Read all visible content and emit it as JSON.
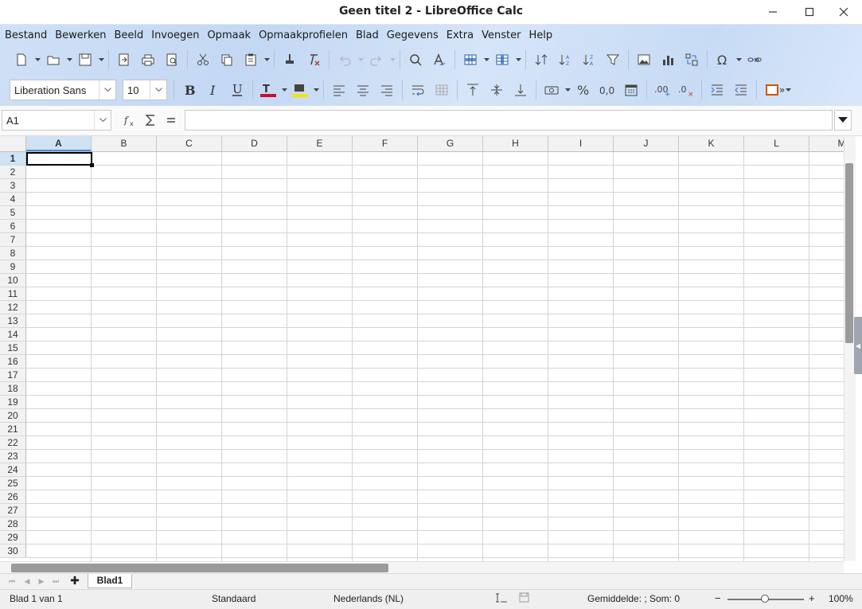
{
  "window": {
    "title": "Geen titel 2 - LibreOffice Calc"
  },
  "menu": [
    "Bestand",
    "Bewerken",
    "Beeld",
    "Invoegen",
    "Opmaak",
    "Opmaakprofielen",
    "Blad",
    "Gegevens",
    "Extra",
    "Venster",
    "Help"
  ],
  "format": {
    "font_name": "Liberation Sans",
    "font_size": "10",
    "font_color": "#c8102e",
    "highlight_color": "#f0e800"
  },
  "formula_bar": {
    "cell_ref": "A1",
    "value": ""
  },
  "grid": {
    "columns": [
      "A",
      "B",
      "C",
      "D",
      "E",
      "F",
      "G",
      "H",
      "I",
      "J",
      "K",
      "L",
      "M"
    ],
    "rows": [
      "1",
      "2",
      "3",
      "4",
      "5",
      "6",
      "7",
      "8",
      "9",
      "10",
      "11",
      "12",
      "13",
      "14",
      "15",
      "16",
      "17",
      "18",
      "19",
      "20",
      "21",
      "22",
      "23",
      "24",
      "25",
      "26",
      "27",
      "28",
      "29",
      "30"
    ],
    "active_cell": "A1"
  },
  "sheets": {
    "tabs": [
      "Blad1"
    ],
    "active": "Blad1"
  },
  "status": {
    "sheet_info": "Blad 1 van 1",
    "page_style": "Standaard",
    "language": "Nederlands (NL)",
    "summary": "Gemiddelde: ; Som: 0",
    "zoom_minus": "−",
    "zoom_plus": "+",
    "zoom": "100%"
  }
}
